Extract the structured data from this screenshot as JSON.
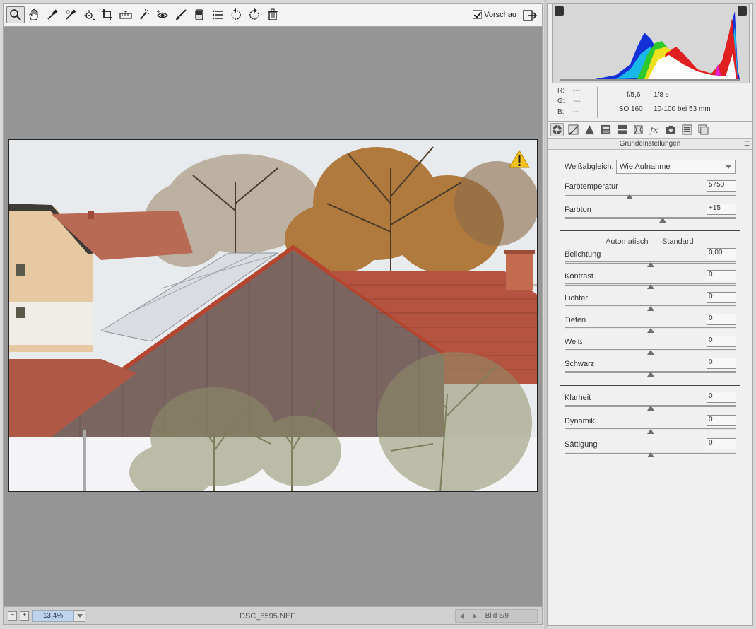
{
  "toolbar": {
    "tools": [
      {
        "name": "zoom-tool",
        "icon": "magnifier-icon",
        "active": true
      },
      {
        "name": "hand-tool",
        "icon": "hand-icon"
      },
      {
        "name": "white-balance-tool",
        "icon": "eyedropper-icon"
      },
      {
        "name": "color-sampler-tool",
        "icon": "color-sampler-icon"
      },
      {
        "name": "targeted-adjustment-tool",
        "icon": "target-adjust-icon"
      },
      {
        "name": "crop-tool",
        "icon": "crop-icon"
      },
      {
        "name": "straighten-tool",
        "icon": "straighten-icon"
      },
      {
        "name": "spot-removal-tool",
        "icon": "spot-removal-icon"
      },
      {
        "name": "red-eye-tool",
        "icon": "red-eye-icon"
      },
      {
        "name": "adjustment-brush-tool",
        "icon": "brush-icon"
      },
      {
        "name": "graduated-filter-tool",
        "icon": "graduated-filter-icon"
      },
      {
        "name": "preferences-tool",
        "icon": "list-icon"
      },
      {
        "name": "rotate-left-tool",
        "icon": "rotate-ccw-icon"
      },
      {
        "name": "rotate-right-tool",
        "icon": "rotate-cw-icon"
      },
      {
        "name": "delete-tool",
        "icon": "trash-icon"
      }
    ],
    "preview_label": "Vorschau",
    "preview_checked": true
  },
  "statusbar": {
    "zoom_minus": "−",
    "zoom_plus": "+",
    "zoom": "13,4%",
    "filename": "DSC_8595.NEF",
    "image_count": "Bild 5/9"
  },
  "histogram": {
    "rgb": {
      "r_label": "R:",
      "r": "---",
      "g_label": "G:",
      "g": "---",
      "b_label": "B:",
      "b": "---"
    },
    "aperture": "f/5,6",
    "shutter": "1/8 s",
    "iso": "ISO 160",
    "lens": "10-100 bei 53 mm"
  },
  "panel": {
    "title": "Grundeinstellungen",
    "tabs": [
      "basic-icon",
      "tone-curve-icon",
      "detail-icon",
      "hsl-icon",
      "split-toning-icon",
      "lens-corrections-icon",
      "effects-icon",
      "camera-calibration-icon",
      "presets-icon",
      "snapshots-icon"
    ],
    "white_balance_label": "Weißabgleich:",
    "white_balance_value": "Wie Aufnahme",
    "auto_label": "Automatisch",
    "default_label": "Standard",
    "sliders": {
      "temperature": {
        "label": "Farbtemperatur",
        "value": "5750",
        "position": 0.38
      },
      "tint": {
        "label": "Farbton",
        "value": "+15",
        "position": 0.57
      },
      "exposure": {
        "label": "Belichtung",
        "value": "0,00",
        "position": 0.5
      },
      "contrast": {
        "label": "Kontrast",
        "value": "0",
        "position": 0.5
      },
      "highlights": {
        "label": "Lichter",
        "value": "0",
        "position": 0.5
      },
      "shadows": {
        "label": "Tiefen",
        "value": "0",
        "position": 0.5
      },
      "whites": {
        "label": "Weiß",
        "value": "0",
        "position": 0.5
      },
      "blacks": {
        "label": "Schwarz",
        "value": "0",
        "position": 0.5
      },
      "clarity": {
        "label": "Klarheit",
        "value": "0",
        "position": 0.5
      },
      "vibrance": {
        "label": "Dynamik",
        "value": "0",
        "position": 0.5
      },
      "saturation": {
        "label": "Sättigung",
        "value": "0",
        "position": 0.5
      }
    }
  }
}
